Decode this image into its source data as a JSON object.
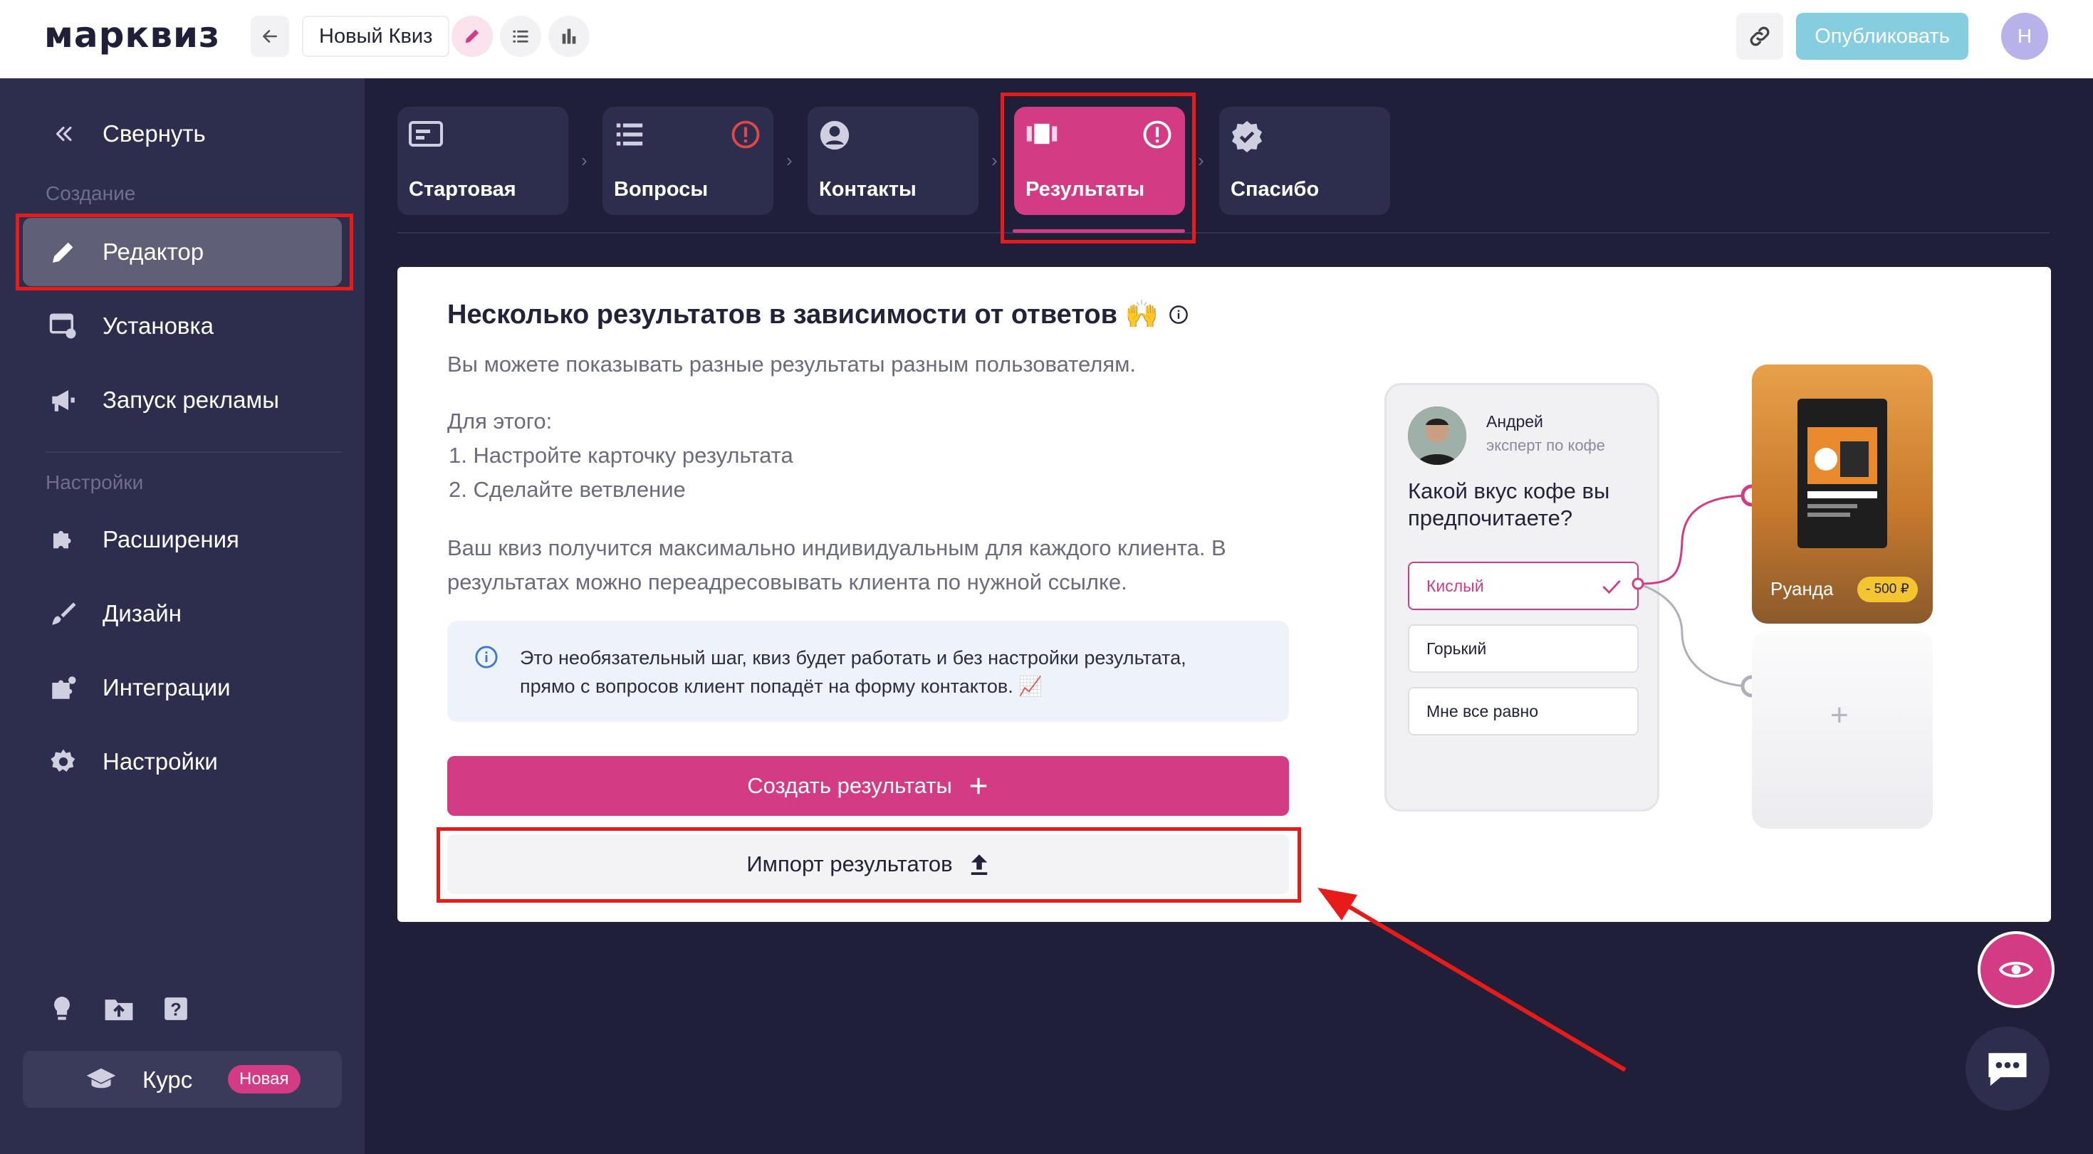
{
  "header": {
    "logo": "марквиз",
    "quiz_name": "Новый Квиз",
    "publish_label": "Опубликовать",
    "avatar_initial": "Н"
  },
  "sidebar": {
    "collapse_label": "Свернуть",
    "section_create": "Создание",
    "section_settings": "Настройки",
    "items": [
      {
        "label": "Редактор",
        "icon": "pencil-icon"
      },
      {
        "label": "Установка",
        "icon": "install-icon"
      },
      {
        "label": "Запуск рекламы",
        "icon": "megaphone-icon"
      },
      {
        "label": "Расширения",
        "icon": "puzzle-plus-icon"
      },
      {
        "label": "Дизайн",
        "icon": "brush-icon"
      },
      {
        "label": "Интеграции",
        "icon": "integration-icon"
      },
      {
        "label": "Настройки",
        "icon": "gear-icon"
      }
    ],
    "course_label": "Курс",
    "course_badge": "Новая"
  },
  "steps": [
    {
      "label": "Стартовая",
      "warning": false
    },
    {
      "label": "Вопросы",
      "warning": true
    },
    {
      "label": "Контакты",
      "warning": false
    },
    {
      "label": "Результаты",
      "warning": true,
      "active": true
    },
    {
      "label": "Спасибо",
      "warning": false
    }
  ],
  "main": {
    "title": "Несколько результатов в зависимости от ответов 🙌",
    "subtitle": "Вы можете показывать разные результаты разным пользователям.",
    "steps_intro": "Для этого:",
    "step1": "1. Настройте карточку результата",
    "step2": "2. Сделайте ветвление",
    "desc_line1": "Ваш квиз получится максимально индивидуальным для каждого клиента. В",
    "desc_line2": "результатах можно переадресовывать клиента по нужной ссылке.",
    "note_line1": "Это необязательный шаг, квиз будет работать и без настройки результата,",
    "note_line2": "прямо с вопросов клиент попадёт на форму контактов. 📈",
    "create_label": "Создать результаты",
    "import_label": "Импорт результатов"
  },
  "illustration": {
    "expert_name": "Андрей",
    "expert_role": "эксперт по кофе",
    "question": "Какой вкус кофе вы предпочитаете?",
    "options": [
      "Кислый",
      "Горький",
      "Мне все равно"
    ],
    "product_name": "Руанда",
    "product_price": "- 500 ₽"
  },
  "colors": {
    "brand_pink": "#d33b84",
    "sidebar_bg": "#2d2d4d",
    "page_bg": "#1f1f3a",
    "publish_bg": "#86cde0",
    "annotation_red": "#e81b1b"
  }
}
